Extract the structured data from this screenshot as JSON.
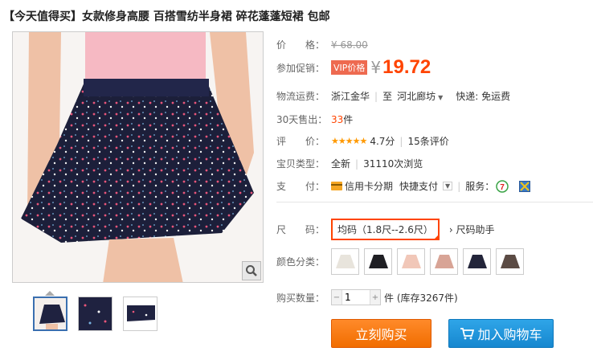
{
  "title": "【今天值得买】女款修身高腰 百搭雪纺半身裙 碎花蓬蓬短裙 包邮",
  "price_row": {
    "label": "价　　格：",
    "value": "¥ 68.00"
  },
  "promo_row": {
    "label": "参加促销：",
    "tag": "VIP价格",
    "yen": "¥",
    "price": "19.72"
  },
  "shipping_row": {
    "label": "物流运费：",
    "from": "浙江金华",
    "to_prefix": "至",
    "to": "河北廊坊",
    "express": "快递: 免运费"
  },
  "sold_row": {
    "label": "30天售出：",
    "count": "33",
    "unit": "件"
  },
  "rating_row": {
    "label": "评　　价：",
    "stars": "★★★★★",
    "score": "4.7分",
    "reviews": "15条评价"
  },
  "type_row": {
    "label": "宝贝类型：",
    "condition": "全新",
    "views": "31110次浏览"
  },
  "pay_row": {
    "label": "支　　付：",
    "credit": "信用卡分期",
    "quick": "快捷支付",
    "service_label": "服务："
  },
  "size_row": {
    "label": "尺　　码：",
    "selected": "均码（1.8尺--2.6尺）",
    "helper": "尺码助手"
  },
  "color_row": {
    "label": "颜色分类："
  },
  "qty_row": {
    "label": "购买数量：",
    "value": "1",
    "stock": "件 (库存3267件)"
  },
  "buttons": {
    "buy": "立刻购买",
    "cart": "加入购物车"
  },
  "swatch_colors": [
    "#e8e4dc",
    "#1f1f24",
    "#f1c7b8",
    "#d8a496",
    "#23253a",
    "#5b4b44"
  ],
  "colors": {
    "accent": "#ff4400",
    "buy": "#f47a12",
    "cart": "#1b8ed6"
  }
}
